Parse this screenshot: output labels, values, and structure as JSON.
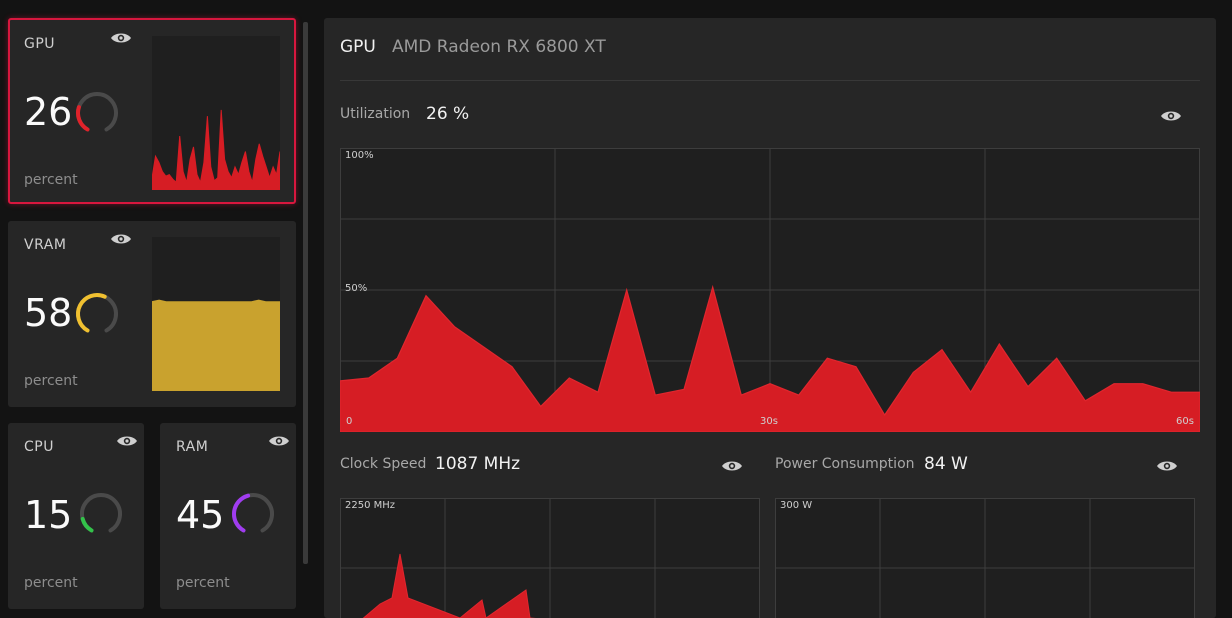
{
  "tiles": {
    "gpu": {
      "name": "GPU",
      "value": "26",
      "unit": "percent",
      "level": 0.26,
      "color": "#e0222a"
    },
    "vram": {
      "name": "VRAM",
      "value": "58",
      "unit": "percent",
      "level": 0.58,
      "color": "#f0c030"
    },
    "cpu": {
      "name": "CPU",
      "value": "15",
      "unit": "percent",
      "level": 0.15,
      "color": "#33c24a"
    },
    "ram": {
      "name": "RAM",
      "value": "45",
      "unit": "percent",
      "level": 0.45,
      "color": "#a03cf0"
    }
  },
  "mini_charts": {
    "gpu": [
      8,
      22,
      18,
      12,
      9,
      10,
      7,
      5,
      35,
      12,
      5,
      20,
      28,
      10,
      5,
      18,
      48,
      15,
      6,
      8,
      52,
      20,
      12,
      8,
      15,
      10,
      18,
      25,
      12,
      5,
      20,
      30,
      22,
      15,
      8,
      15,
      10,
      25
    ],
    "vram": [
      58,
      59,
      58,
      58,
      58,
      58,
      58,
      58,
      58,
      58,
      58,
      58,
      58,
      58,
      58,
      59,
      58,
      58,
      58
    ]
  },
  "panel": {
    "title": "GPU",
    "device": "AMD Radeon RX 6800 XT",
    "utilization": {
      "label": "Utilization",
      "value": "26 %",
      "chart": {
        "type": "area",
        "ymax_label": "100%",
        "ymid_label": "50%",
        "x_labels": [
          "0",
          "30s",
          "60s"
        ],
        "ylim": [
          0,
          100
        ],
        "x": [
          0,
          2,
          4,
          6,
          8,
          10,
          12,
          14,
          16,
          18,
          20,
          22,
          24,
          26,
          28,
          30,
          32,
          34,
          36,
          38,
          40,
          42,
          44,
          46,
          48,
          50,
          52,
          54,
          56,
          58,
          60
        ],
        "values": [
          18,
          19,
          26,
          48,
          37,
          30,
          23,
          9,
          19,
          14,
          50,
          13,
          15,
          51,
          13,
          17,
          13,
          26,
          23,
          6,
          21,
          29,
          14,
          31,
          16,
          26,
          11,
          17,
          17,
          14,
          14
        ],
        "color": "#d61d24"
      }
    },
    "clock": {
      "label": "Clock Speed",
      "value": "1087 MHz",
      "chart": {
        "type": "area",
        "ymax_label": "2250 MHz"
      }
    },
    "power": {
      "label": "Power Consumption",
      "value": "84 W",
      "chart": {
        "type": "area",
        "ymax_label": "300 W"
      }
    }
  },
  "icons": {
    "eye": "eye-icon"
  }
}
